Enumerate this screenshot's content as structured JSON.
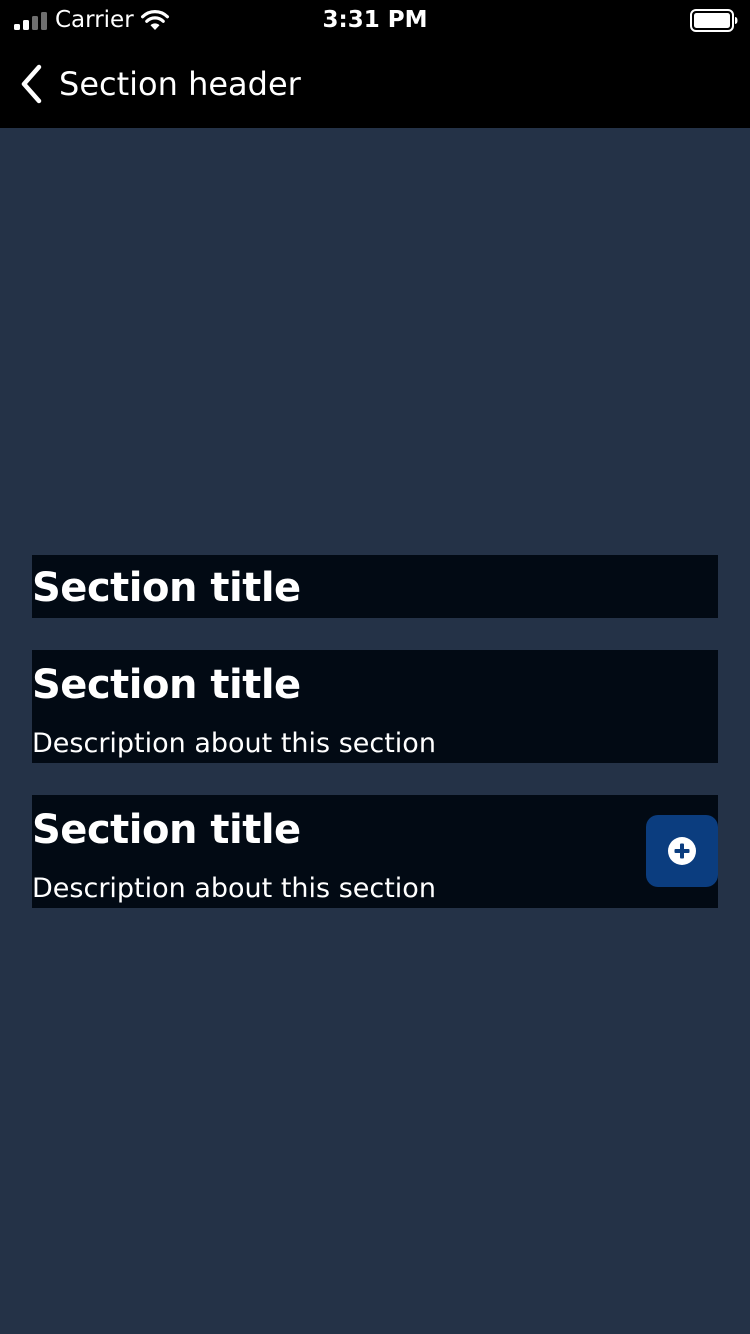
{
  "status_bar": {
    "carrier": "Carrier",
    "time": "3:31 PM",
    "signal_icon": "cellular-signal-icon",
    "wifi_icon": "wifi-icon",
    "battery_icon": "battery-icon"
  },
  "nav": {
    "back_icon": "chevron-left-icon",
    "title": "Section header"
  },
  "sections": [
    {
      "title": "Section title"
    },
    {
      "title": "Section title",
      "description": "Description about this section"
    },
    {
      "title": "Section title",
      "description": "Description about this section",
      "action_icon": "plus-circle-icon"
    }
  ],
  "colors": {
    "background": "#243247",
    "bar": "#000000",
    "section_background": "#020a14",
    "accent": "#0b3d7f",
    "text": "#ffffff"
  }
}
